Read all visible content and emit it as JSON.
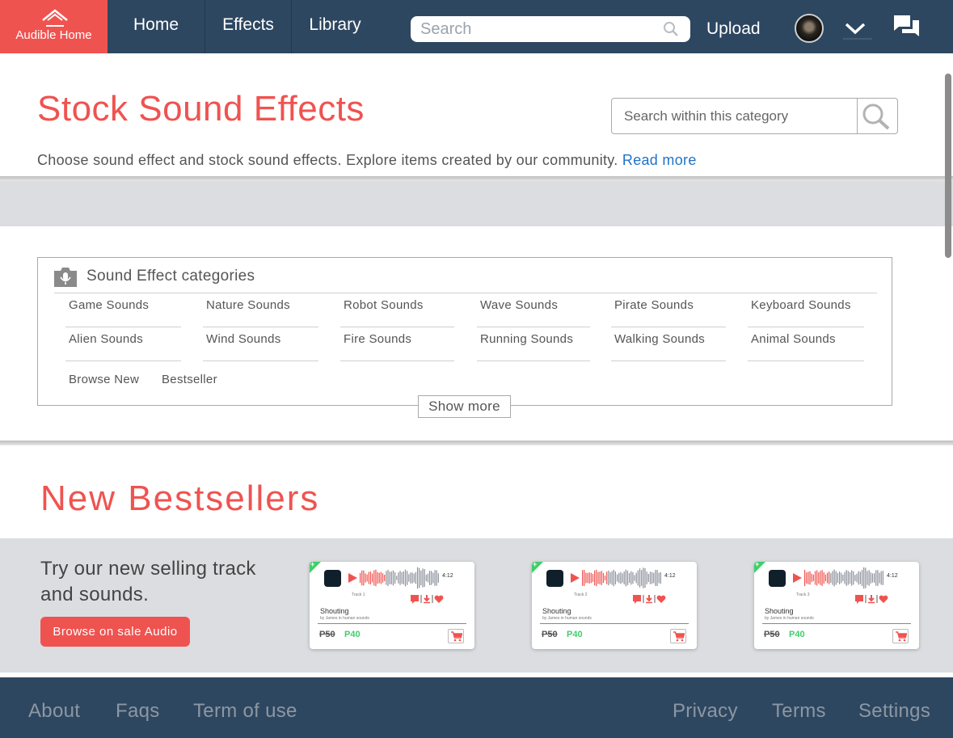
{
  "nav": {
    "logo_text": "Audible Home",
    "items": [
      {
        "label": "Home"
      },
      {
        "label": "Effects"
      },
      {
        "label": "Library"
      }
    ],
    "search_placeholder": "Search",
    "upload_label": "Upload",
    "icons": {
      "search": "search-icon",
      "user": "avatar",
      "menu": "chevron-down-icon",
      "messages": "chat-icon"
    }
  },
  "header": {
    "title": "Stock Sound Effects",
    "category_search_placeholder": "Search within this category",
    "description": "Choose sound effect and stock sound effects. Explore items created by our community.",
    "read_more": "Read more"
  },
  "categories": {
    "heading": "Sound Effect categories",
    "items": [
      "Game Sounds",
      "Nature Sounds",
      "Robot Sounds",
      "Wave Sounds",
      "Pirate Sounds",
      "Keyboard Sounds",
      "Alien Sounds",
      "Wind Sounds",
      "Fire Sounds",
      "Running Sounds",
      "Walking Sounds",
      "Animal Sounds"
    ],
    "links": [
      "Browse New",
      "Bestseller"
    ],
    "show_more": "Show more"
  },
  "bestsellers": {
    "title": "New Bestsellers",
    "promo_text": "Try our new selling track and sounds.",
    "promo_button": "Browse on sale Audio",
    "cards": [
      {
        "track": "Track 1",
        "duration": "4:12",
        "song": "Shouting",
        "artist": "by James in human sounds",
        "old_price": "P50",
        "new_price": "P40"
      },
      {
        "track": "Track 2",
        "duration": "4:12",
        "song": "Shouting",
        "artist": "by James in human sounds",
        "old_price": "P50",
        "new_price": "P40"
      },
      {
        "track": "Track 3",
        "duration": "4:12",
        "song": "Shouting",
        "artist": "by James in human sounds",
        "old_price": "P50",
        "new_price": "P40"
      }
    ]
  },
  "footer": {
    "links": [
      "About",
      "Faqs",
      "Term of use",
      "Privacy",
      "Terms",
      "Settings"
    ]
  },
  "colors": {
    "brand_red": "#ef5350",
    "nav_bg": "#2e4760",
    "price_green": "#3ecf6a",
    "link_blue": "#1e73c9",
    "band_gray": "#dcdde1"
  }
}
